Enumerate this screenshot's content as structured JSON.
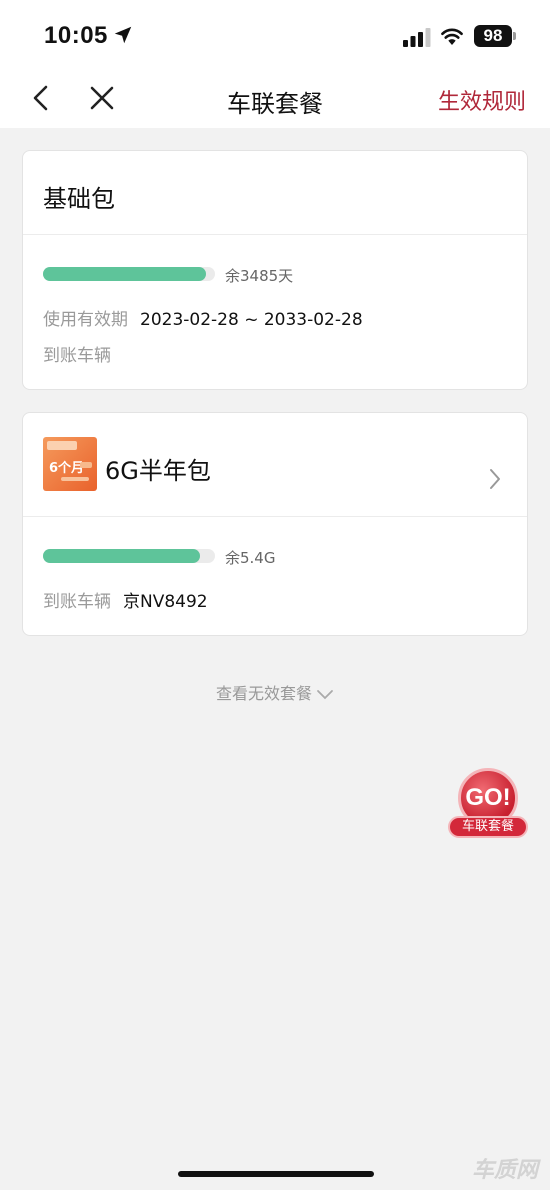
{
  "status_bar": {
    "time": "10:05",
    "battery": "98"
  },
  "nav": {
    "title": "车联套餐",
    "action": "生效规则"
  },
  "cards": [
    {
      "title": "基础包",
      "progress_label": "余3485天",
      "progress_fraction": 0.95,
      "validity_label": "使用有效期",
      "validity_value": "2023-02-28 ~ 2033-02-28",
      "vehicle_label": "到账车辆",
      "vehicle_value": ""
    },
    {
      "title": "6G半年包",
      "thumb_text": "6个月",
      "progress_label": "余5.4G",
      "progress_fraction": 0.91,
      "vehicle_label": "到账车辆",
      "vehicle_value": "京NV8492"
    }
  ],
  "invalid_link": "查看无效套餐",
  "go_badge": {
    "text": "GO!",
    "label": "车联套餐"
  },
  "watermark": "车质网",
  "colors": {
    "accent": "#b0283a",
    "progress": "#5ec49a"
  }
}
